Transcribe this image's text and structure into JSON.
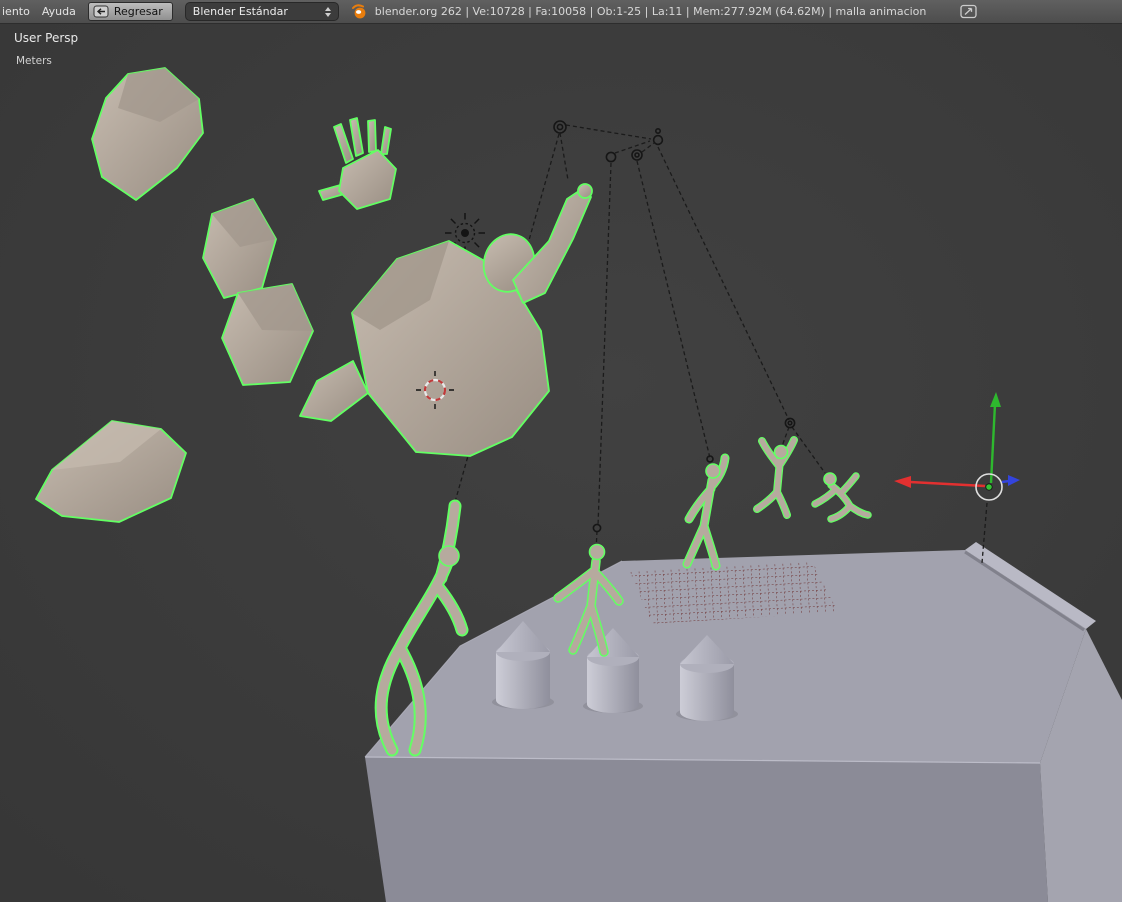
{
  "header": {
    "menu_left_partial": "iento",
    "menu_ayuda": "Ayuda",
    "back_button_label": "Regresar",
    "scene_selector_value": "Blender Estándar",
    "status_text": "blender.org 262 | Ve:10728 | Fa:10058 | Ob:1-25 | La:11 | Mem:277.92M (64.62M) | malla animacion"
  },
  "viewport": {
    "view_mode_label": "User Persp",
    "grid_unit_label": "Meters"
  },
  "icons": {
    "back_button_icon": "back-arrow-icon",
    "scene_selector_icon": "up-down-arrows-icon",
    "status_icon": "blender-logo-icon",
    "window_icon": "pop-out-window-icon"
  },
  "colors": {
    "header_bg": "#565656",
    "viewport_bg": "#3d3d3d",
    "selection_outline": "#63ff63",
    "figure_skin": "#b3a79b",
    "platform_top": "#a2a2ae",
    "platform_front": "#8b8b97",
    "platform_side": "#a4a4af",
    "grid_patch_red": "#6e3232",
    "axis_x_red": "#e23030",
    "axis_z_green": "#2eb82e",
    "axis_y_blue": "#3344dd",
    "cursor_red": "#c03a3a"
  }
}
